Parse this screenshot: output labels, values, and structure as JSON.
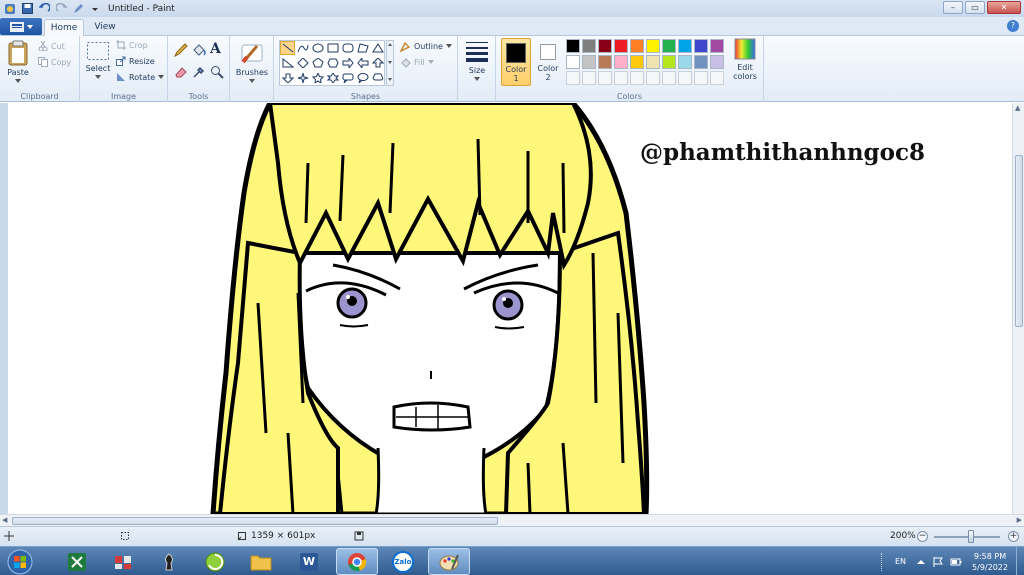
{
  "window": {
    "title": "Untitled - Paint",
    "controls": {
      "minimize": "–",
      "maximize": "▭",
      "close": "✕"
    }
  },
  "tabs": {
    "home": "Home",
    "view": "View"
  },
  "help": "?",
  "ribbon": {
    "clipboard": {
      "paste": "Paste",
      "cut": "Cut",
      "copy": "Copy",
      "label": "Clipboard"
    },
    "image": {
      "select": "Select",
      "crop": "Crop",
      "resize": "Resize",
      "rotate": "Rotate",
      "label": "Image"
    },
    "tools": {
      "label": "Tools"
    },
    "brushes": {
      "label": "Brushes"
    },
    "shapes": {
      "outline": "Outline",
      "fill": "Fill",
      "label": "Shapes"
    },
    "size": {
      "label": "Size"
    },
    "colors": {
      "color1": "Color\n1",
      "color2": "Color\n2",
      "edit": "Edit colors",
      "label": "Colors",
      "active_color1": "#000000",
      "active_color2": "#ffffff",
      "palette_row1": [
        "#000000",
        "#7f7f7f",
        "#880015",
        "#ed1c24",
        "#ff7f27",
        "#fff200",
        "#22b14c",
        "#00a2e8",
        "#3f48cc",
        "#a349a4"
      ],
      "palette_row2": [
        "#ffffff",
        "#c3c3c3",
        "#b97a57",
        "#ffaec9",
        "#ffc90e",
        "#efe4b0",
        "#b5e61d",
        "#99d9ea",
        "#7092be",
        "#c8bfe7"
      ]
    }
  },
  "canvas": {
    "watermark": "@phamthithanhngoc8",
    "hair_color": "#fff77a",
    "eye_color": "#9c94cf"
  },
  "status": {
    "dimensions": "1359 × 601px",
    "zoom": "200%",
    "zoom_level_percent": 200
  },
  "taskbar": {
    "items": [
      "excel-icon",
      "app-icon",
      "chess-icon",
      "green-app-icon",
      "folder-icon",
      "word-icon",
      "chrome-icon",
      "zalo-icon",
      "paint-icon"
    ],
    "zalo_label": "Zalo",
    "word_label": "W",
    "language": "EN",
    "time": "9:58 PM",
    "date": "5/9/2022"
  }
}
